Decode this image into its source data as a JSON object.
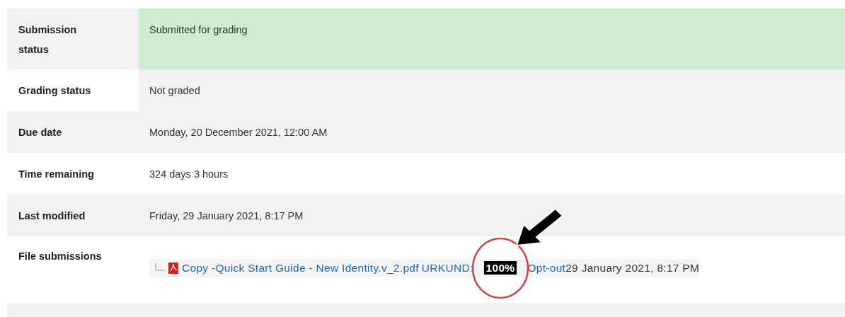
{
  "rows": [
    {
      "label": "Submission status",
      "value": "Submitted for grading",
      "kind": "success"
    },
    {
      "label": "Grading status",
      "value": "Not graded",
      "kind": "neutral"
    },
    {
      "label": "Due date",
      "value": "Monday, 20 December 2021, 12:00 AM"
    },
    {
      "label": "Time remaining",
      "value": "324 days 3 hours"
    },
    {
      "label": "Last modified",
      "value": "Friday, 29 January 2021, 8:17 PM"
    },
    {
      "label": "File submissions",
      "file": {
        "name": "Copy -Quick Start Guide - New Identity.v_2.pdf",
        "checker": "URKUND:",
        "score": "100%",
        "optout": "Opt-out",
        "date": "29 January 2021, 8:17 PM"
      }
    }
  ]
}
